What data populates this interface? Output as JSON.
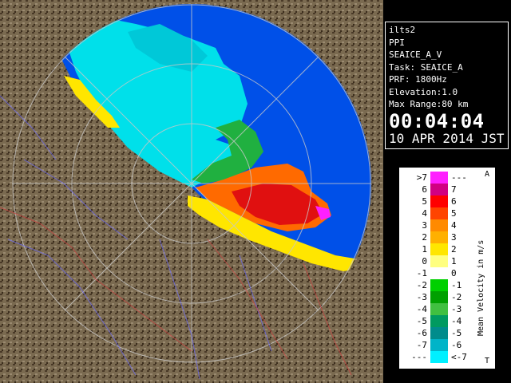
{
  "info": {
    "site": "ilts2",
    "mode": "PPI",
    "product": "SEAICE_A_V",
    "task": "Task: SEAICE_A",
    "prf": "PRF: 1800Hz",
    "elevation": "Elevation:1.0",
    "range": "Max Range:80 km",
    "time": "00:04:04",
    "date": "10 APR 2014 JST"
  },
  "legend": {
    "title": "Mean Velocity in m/s",
    "top_mark": "A",
    "bottom_mark": "T",
    "rows": [
      {
        "left": ">7",
        "right": "---",
        "color": "#ff20ff"
      },
      {
        "left": "6",
        "right": "7",
        "color": "#d10082"
      },
      {
        "left": "5",
        "right": "6",
        "color": "#ff0000"
      },
      {
        "left": "4",
        "right": "5",
        "color": "#ff4400"
      },
      {
        "left": "3",
        "right": "4",
        "color": "#ff8a00"
      },
      {
        "left": "2",
        "right": "3",
        "color": "#ffb000"
      },
      {
        "left": "1",
        "right": "2",
        "color": "#ffe600"
      },
      {
        "left": "0",
        "right": "1",
        "color": "#ffff80"
      },
      {
        "left": "-1",
        "right": "0",
        "color": "#ffffff"
      },
      {
        "left": "-2",
        "right": "-1",
        "color": "#00d000"
      },
      {
        "left": "-3",
        "right": "-2",
        "color": "#00a000"
      },
      {
        "left": "-4",
        "right": "-3",
        "color": "#40c040"
      },
      {
        "left": "-5",
        "right": "-4",
        "color": "#009a60"
      },
      {
        "left": "-6",
        "right": "-5",
        "color": "#008c8c"
      },
      {
        "left": "-7",
        "right": "-6",
        "color": "#00b4c8"
      },
      {
        "left": "---",
        "right": "<-7",
        "color": "#00f0ff"
      }
    ]
  },
  "colors": {
    "sea": "#0050e8",
    "land": "#7a6a50",
    "ring": "#c8c8c8"
  }
}
